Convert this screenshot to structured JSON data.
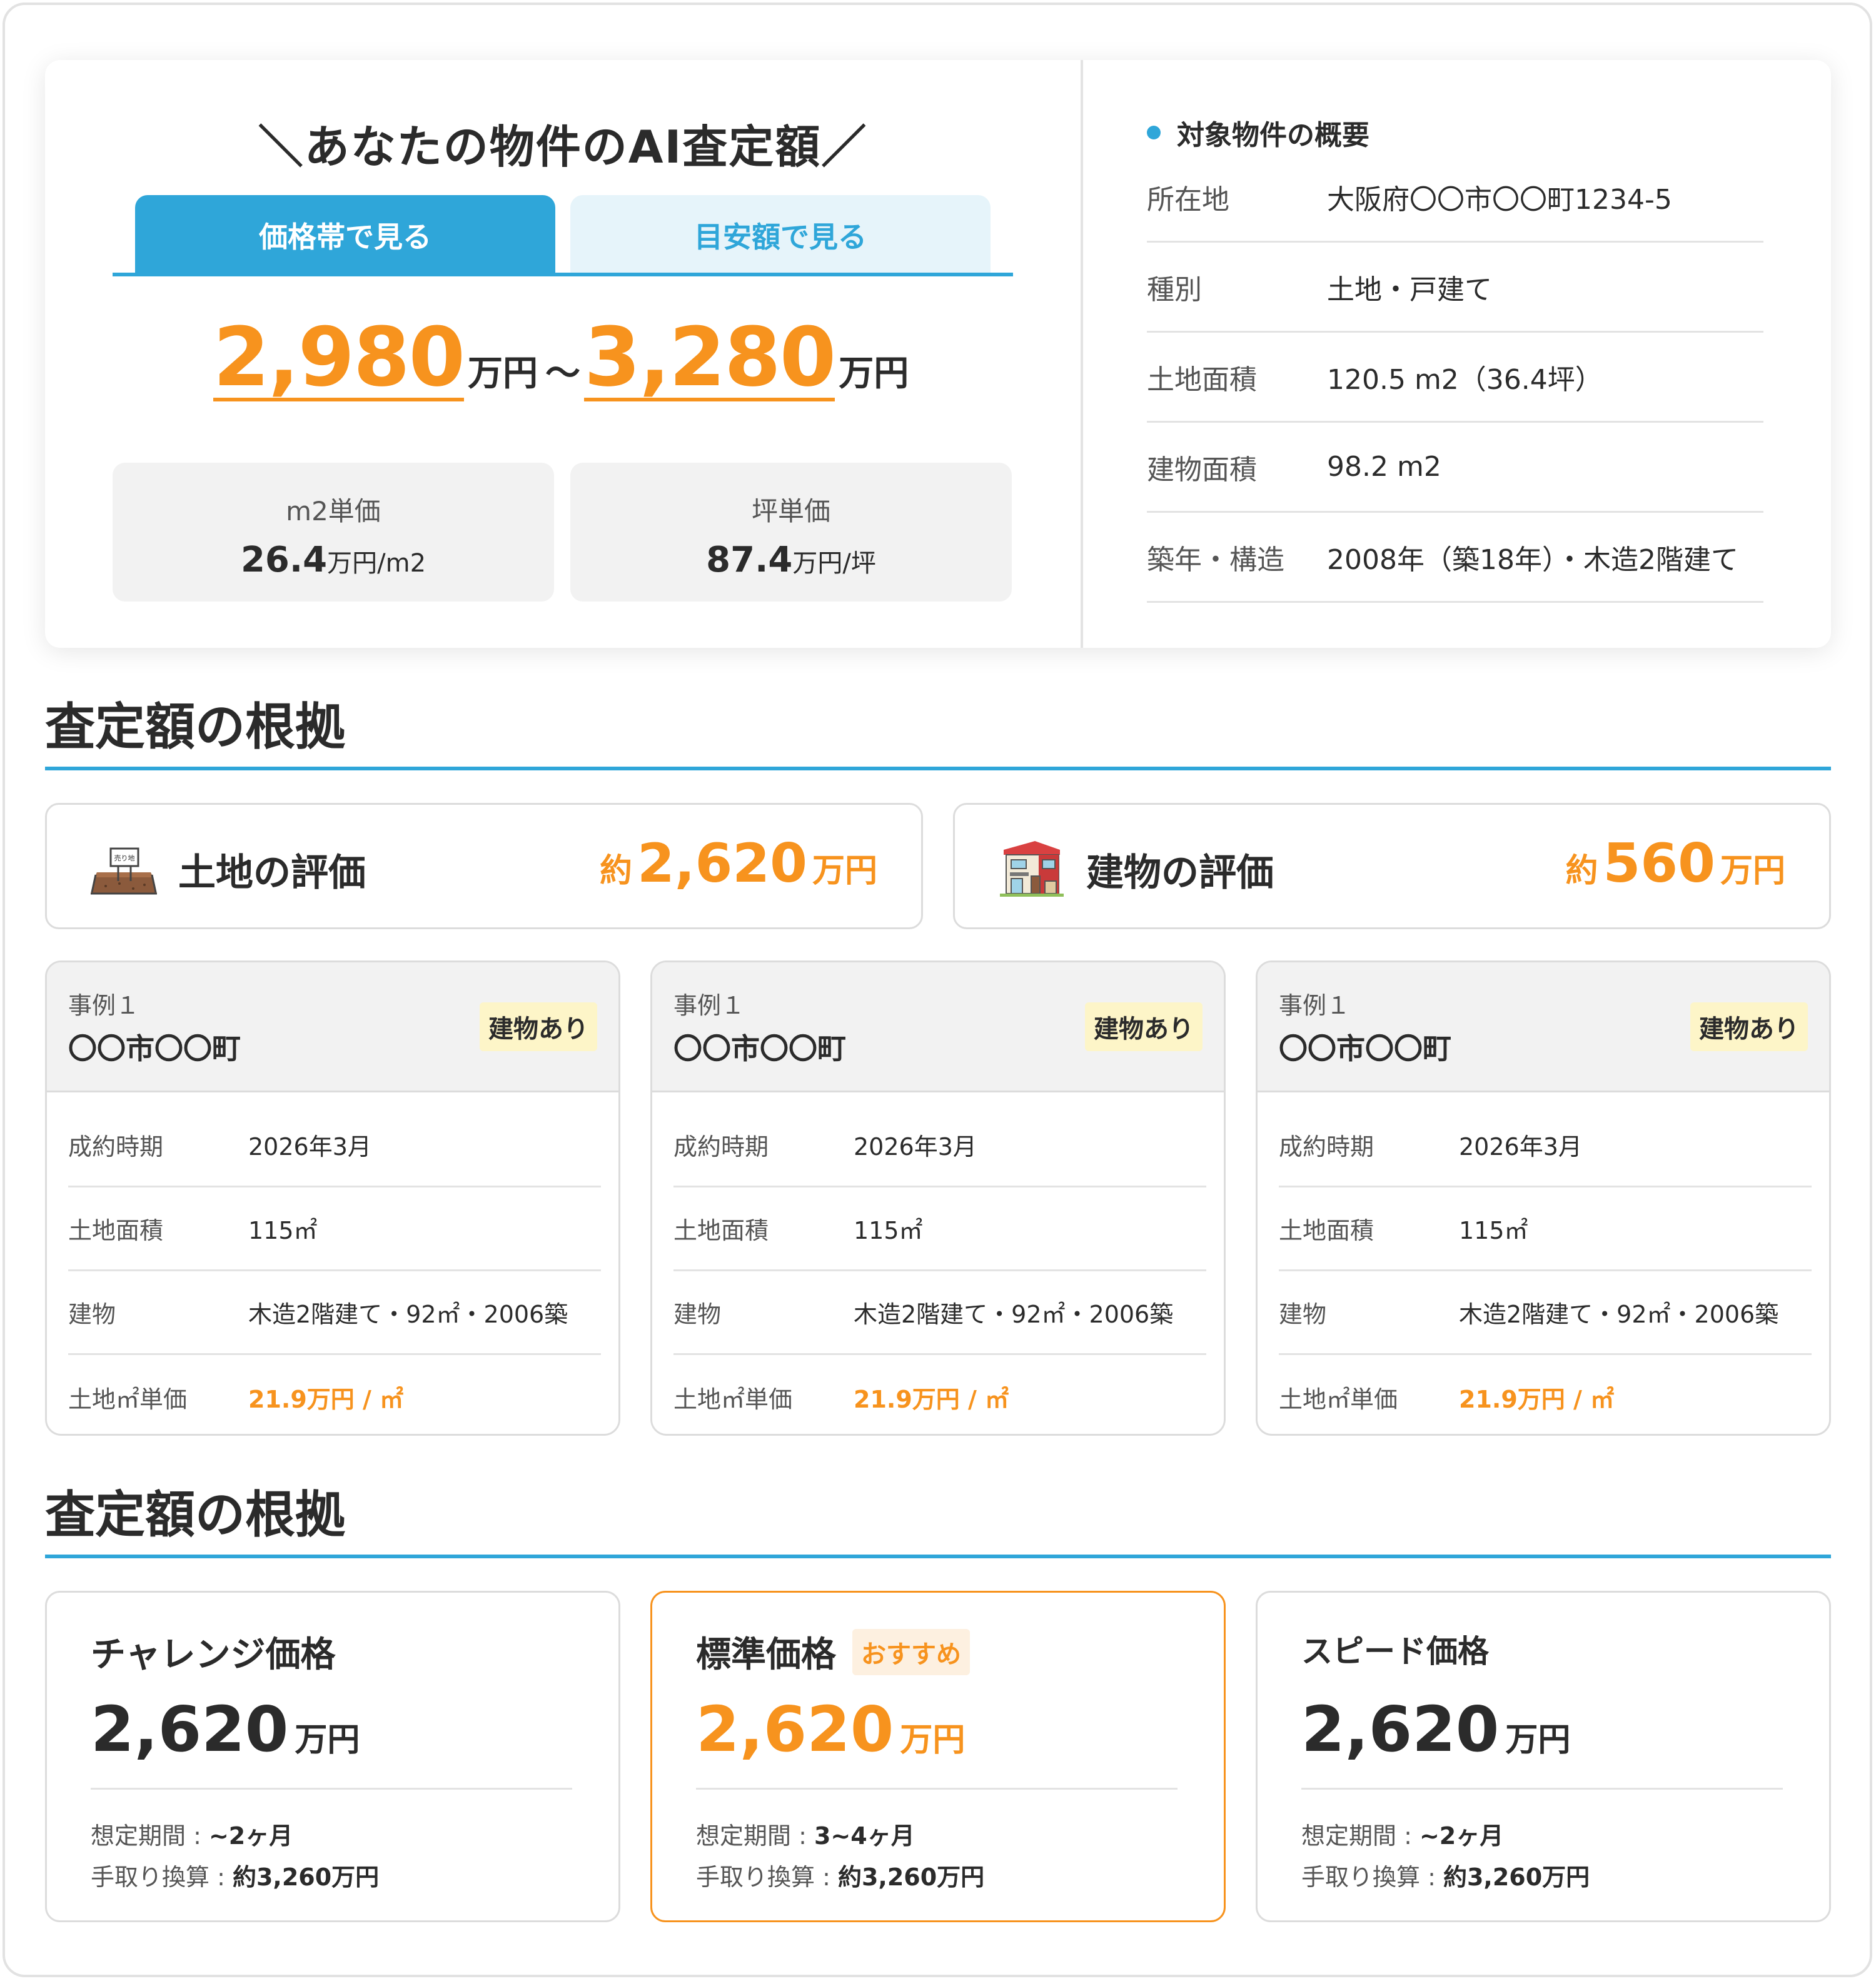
{
  "valuation": {
    "title": "＼あなたの物件のAI査定額／",
    "tabs": {
      "range_label": "価格帯で見る",
      "guide_label": "目安額で見る"
    },
    "price_low": "2,980",
    "price_high": "3,280",
    "unit": "万円",
    "tilde": "～",
    "unit_prices": [
      {
        "label": "m2単価",
        "value": "26.4",
        "unit": "万円/m2"
      },
      {
        "label": "坪単価",
        "value": "87.4",
        "unit": "万円/坪"
      }
    ]
  },
  "summary": {
    "title": "対象物件の概要",
    "rows": [
      {
        "k": "所在地",
        "v": "大阪府〇〇市〇〇町1234-5"
      },
      {
        "k": "種別",
        "v": "土地・戸建て"
      },
      {
        "k": "土地面積",
        "v": "120.5 m2（36.4坪）"
      },
      {
        "k": "建物面積",
        "v": "98.2 m2"
      },
      {
        "k": "築年・構造",
        "v": "2008年（築18年）・木造2階建て"
      }
    ]
  },
  "basis": {
    "title1": "査定額の根拠",
    "title2": "査定額の根拠",
    "land": {
      "name": "土地の評価",
      "prefix": "約",
      "value": "2,620",
      "unit": "万円",
      "sign_text": "売り地"
    },
    "building": {
      "name": "建物の評価",
      "prefix": "約",
      "value": "560",
      "unit": "万円"
    }
  },
  "cases": [
    {
      "no": "事例１",
      "location": "〇〇市〇〇町",
      "badge": "建物あり",
      "rows": [
        {
          "k": "成約時期",
          "v": "2026年3月"
        },
        {
          "k": "土地面積",
          "v": "115㎡"
        },
        {
          "k": "建物",
          "v": "木造2階建て・92㎡・2006築"
        },
        {
          "k": "土地㎡単価",
          "v": "21.9万円 / ㎡"
        }
      ]
    },
    {
      "no": "事例１",
      "location": "〇〇市〇〇町",
      "badge": "建物あり",
      "rows": [
        {
          "k": "成約時期",
          "v": "2026年3月"
        },
        {
          "k": "土地面積",
          "v": "115㎡"
        },
        {
          "k": "建物",
          "v": "木造2階建て・92㎡・2006築"
        },
        {
          "k": "土地㎡単価",
          "v": "21.9万円 / ㎡"
        }
      ]
    },
    {
      "no": "事例１",
      "location": "〇〇市〇〇町",
      "badge": "建物あり",
      "rows": [
        {
          "k": "成約時期",
          "v": "2026年3月"
        },
        {
          "k": "土地面積",
          "v": "115㎡"
        },
        {
          "k": "建物",
          "v": "木造2階建て・92㎡・2006築"
        },
        {
          "k": "土地㎡単価",
          "v": "21.9万円 / ㎡"
        }
      ]
    }
  ],
  "prices": [
    {
      "name": "チャレンジ価格",
      "value": "2,620",
      "unit": "万円",
      "period_label": "想定期間 : ",
      "period": "~2ヶ月",
      "net_label": "手取り換算 : ",
      "net": "約3,260万円"
    },
    {
      "name": "標準価格",
      "badge": "おすすめ",
      "value": "2,620",
      "unit": "万円",
      "period_label": "想定期間 : ",
      "period": "3~4ヶ月",
      "net_label": "手取り換算 : ",
      "net": "約3,260万円"
    },
    {
      "name": "スピード価格",
      "value": "2,620",
      "unit": "万円",
      "period_label": "想定期間 : ",
      "period": "~2ヶ月",
      "net_label": "手取り換算 : ",
      "net": "約3,260万円"
    }
  ],
  "colors": {
    "accent_blue": "#2fa6d9",
    "accent_orange": "#f7931e",
    "badge_yellow": "#fdf5c8"
  }
}
